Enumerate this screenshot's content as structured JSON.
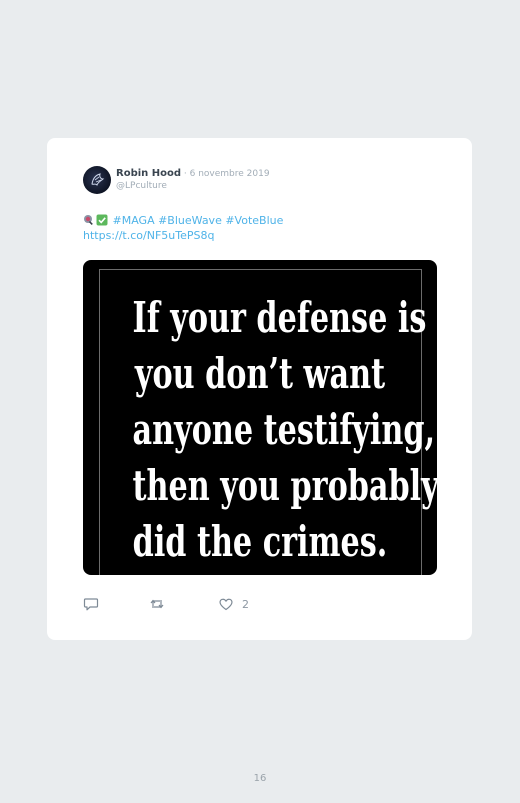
{
  "tweet": {
    "author_name": "Robin Hood",
    "separator": " · ",
    "date": "6 novembre 2019",
    "handle": "@LPculture",
    "emojis": [
      "microphone-emoji",
      "check-mark-emoji"
    ],
    "hashtags_line": "#MAGA #BlueWave #VoteBlue",
    "link": "https://t.co/NF5uTePS8q",
    "image_text_lines": [
      "If your defense is",
      "you don’t want",
      "anyone testifying,",
      "then you probably",
      "did the crimes."
    ],
    "actions": {
      "reply_icon": "reply-icon",
      "retweet_icon": "retweet-icon",
      "like_icon": "heart-icon",
      "like_count": "2"
    }
  },
  "page": {
    "number": "16"
  },
  "colors": {
    "background": "#e9ecee",
    "card": "#ffffff",
    "link": "#4fb3e8",
    "image_background": "#000000"
  }
}
